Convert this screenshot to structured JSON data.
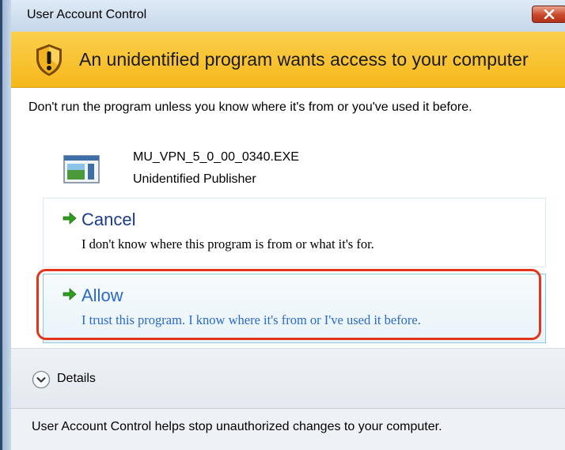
{
  "window": {
    "title": "User Account Control"
  },
  "banner": {
    "heading": "An unidentified program wants access to your computer",
    "icon": "warning-shield-icon"
  },
  "content": {
    "warning": "Don't run the program unless you know where it's from or you've used it before.",
    "program_name": "MU_VPN_5_0_00_0340.EXE",
    "publisher": "Unidentified Publisher"
  },
  "options": {
    "cancel": {
      "title": "Cancel",
      "description": "I don't know where this program is from or what it's for."
    },
    "allow": {
      "title": "Allow",
      "description": "I trust this program. I know where it's from or I've used it before."
    }
  },
  "details": {
    "label": "Details"
  },
  "footer": {
    "text": "User Account Control helps stop unauthorized changes to your computer."
  },
  "colors": {
    "banner": "#f6b81a",
    "highlight": "#e2361c",
    "link_blue": "#2b69c9",
    "arrow_green": "#2e9e1f"
  }
}
